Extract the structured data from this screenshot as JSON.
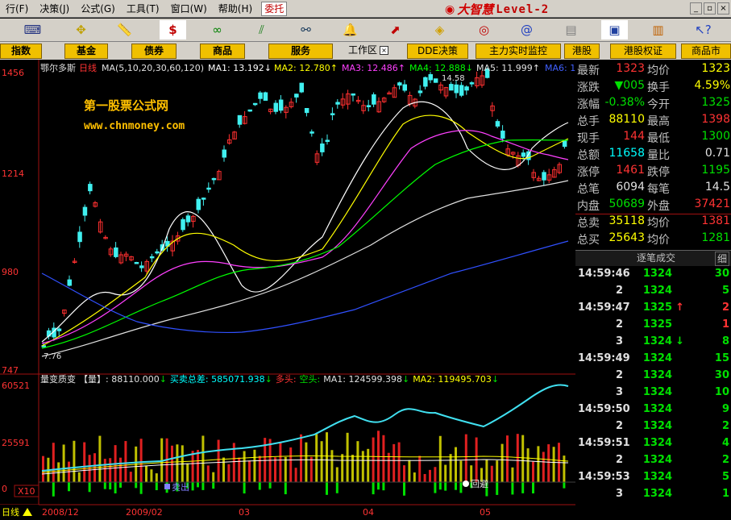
{
  "menu": [
    "行(F)",
    "决策(J)",
    "公式(G)",
    "工具(T)",
    "窗口(W)",
    "帮助(H)"
  ],
  "menu_order": "truncated",
  "weituo": "委托",
  "logo": {
    "brand": "大智慧",
    "level": "Level-2"
  },
  "tabs": [
    "指数",
    "基金",
    "债券",
    "商品",
    "服务",
    "工作区",
    "DDE决策",
    "主力实时监控",
    "港股",
    "港股权证",
    "商品市"
  ],
  "toolbar_icons": [
    "keyboard-icon",
    "move-cross-icon",
    "ruler-icon",
    "dollar-icon",
    "glasses-icon",
    "stripes-icon",
    "binoculars-icon",
    "bell-icon",
    "arrow-up-box-icon",
    "diamond-icon",
    "ring-icon",
    "swirl-icon",
    "document-icon",
    "window-icon",
    "bars-color-icon",
    "help-arrow-icon"
  ],
  "stock": {
    "name": "鄂尔多斯",
    "period": "日线",
    "ma_spec": "MA(5,10,20,30,60,120)",
    "ma": [
      {
        "label": "MA1:",
        "value": "13.192",
        "arrow": "↓",
        "color": "#ffffff"
      },
      {
        "label": "MA2:",
        "value": "12.780",
        "arrow": "↑",
        "color": "#ffff00"
      },
      {
        "label": "MA3:",
        "value": "12.486",
        "arrow": "↑",
        "color": "#ff40ff"
      },
      {
        "label": "MA4:",
        "value": "12.888",
        "arrow": "↓",
        "color": "#00ff00"
      },
      {
        "label": "MA5:",
        "value": "11.999",
        "arrow": "↑",
        "color": "#e0e0e0"
      },
      {
        "label": "MA6:",
        "value": "10",
        "arrow": "",
        "color": "#4060ff"
      }
    ],
    "high_label": "14.58",
    "low_label": "7.76"
  },
  "watermark": {
    "line1": "第一股票公式网",
    "line2": "www.chnmoney.com"
  },
  "y_axis": [
    "1456",
    "1214",
    "980",
    "747"
  ],
  "vol_axis": [
    "60521",
    "25591",
    "0"
  ],
  "vol_x10": "X10",
  "x_axis": [
    "2008/12",
    "2009/02",
    "03",
    "04",
    "05"
  ],
  "period_btn": "日线",
  "vol_header": {
    "title": "量变质变",
    "bracket": "【量】",
    "vol": ": 88110.000",
    "vol_arrow": "↓",
    "diff_label": "买卖总差:",
    "diff": " 585071.938",
    "diff_arrow": "↓",
    "duo": "多头:",
    "kong": "空头:",
    "ma1": "MA1: 124599.398",
    "ma1_arrow": "↓",
    "ma2": "MA2: 119495.703",
    "ma2_arrow": "↓"
  },
  "vol_markers": {
    "sell": "卖出",
    "avoid": "回避"
  },
  "quote": [
    {
      "l1": "最新",
      "v1": "1323",
      "c1": "#ff3333",
      "l2": "均价",
      "v2": "1323",
      "c2": "#ffff00"
    },
    {
      "l1": "涨跌",
      "v1": "▼005",
      "c1": "#00e000",
      "l2": "换手",
      "v2": "4.59%",
      "c2": "#ffff00"
    },
    {
      "l1": "涨幅",
      "v1": "-0.38%",
      "c1": "#00e000",
      "l2": "今开",
      "v2": "1325",
      "c2": "#00e000"
    },
    {
      "l1": "总手",
      "v1": "88110",
      "c1": "#ffff00",
      "l2": "最高",
      "v2": "1398",
      "c2": "#ff3333"
    },
    {
      "l1": "现手",
      "v1": "144",
      "c1": "#ff3333",
      "l2": "最低",
      "v2": "1300",
      "c2": "#00e000"
    },
    {
      "l1": "总额",
      "v1": "11658",
      "c1": "#00ffff",
      "l2": "量比",
      "v2": "0.71",
      "c2": "#e0e0e0"
    },
    {
      "l1": "涨停",
      "v1": "1461",
      "c1": "#ff3333",
      "l2": "跌停",
      "v2": "1195",
      "c2": "#00e000"
    },
    {
      "l1": "总笔",
      "v1": "6094",
      "c1": "#e0e0e0",
      "l2": "每笔",
      "v2": "14.5",
      "c2": "#e0e0e0"
    },
    {
      "l1": "内盘",
      "v1": "50689",
      "c1": "#00e000",
      "l2": "外盘",
      "v2": "37421",
      "c2": "#ff3333"
    },
    {
      "l1": "总卖",
      "v1": "35118",
      "c1": "#ffff00",
      "l2": "均价",
      "v2": "1381",
      "c2": "#ff3333"
    },
    {
      "l1": "总买",
      "v1": "25643",
      "c1": "#ffff00",
      "l2": "均价",
      "v2": "1281",
      "c2": "#00e000"
    }
  ],
  "trades_header": {
    "title": "逐笔成交",
    "btn": "细"
  },
  "trades": [
    {
      "t": "14:59:46",
      "p": "1324",
      "a": "",
      "ac": "",
      "v": "30",
      "vc": "#00e000"
    },
    {
      "t": "2",
      "p": "1324",
      "a": "",
      "ac": "",
      "v": "5",
      "vc": "#00e000"
    },
    {
      "t": "14:59:47",
      "p": "1325",
      "a": "↑",
      "ac": "#ff3333",
      "v": "2",
      "vc": "#ff3333"
    },
    {
      "t": "2",
      "p": "1325",
      "a": "",
      "ac": "",
      "v": "1",
      "vc": "#ff3333"
    },
    {
      "t": "3",
      "p": "1324",
      "a": "↓",
      "ac": "#00e000",
      "v": "8",
      "vc": "#00e000"
    },
    {
      "t": "14:59:49",
      "p": "1324",
      "a": "",
      "ac": "",
      "v": "15",
      "vc": "#00e000"
    },
    {
      "t": "2",
      "p": "1324",
      "a": "",
      "ac": "",
      "v": "30",
      "vc": "#00e000"
    },
    {
      "t": "3",
      "p": "1324",
      "a": "",
      "ac": "",
      "v": "10",
      "vc": "#00e000"
    },
    {
      "t": "14:59:50",
      "p": "1324",
      "a": "",
      "ac": "",
      "v": "9",
      "vc": "#00e000"
    },
    {
      "t": "2",
      "p": "1324",
      "a": "",
      "ac": "",
      "v": "2",
      "vc": "#00e000"
    },
    {
      "t": "14:59:51",
      "p": "1324",
      "a": "",
      "ac": "",
      "v": "4",
      "vc": "#00e000"
    },
    {
      "t": "2",
      "p": "1324",
      "a": "",
      "ac": "",
      "v": "2",
      "vc": "#00e000"
    },
    {
      "t": "14:59:53",
      "p": "1324",
      "a": "",
      "ac": "",
      "v": "5",
      "vc": "#00e000"
    },
    {
      "t": "3",
      "p": "1324",
      "a": "",
      "ac": "",
      "v": "1",
      "vc": "#00e000"
    }
  ]
}
